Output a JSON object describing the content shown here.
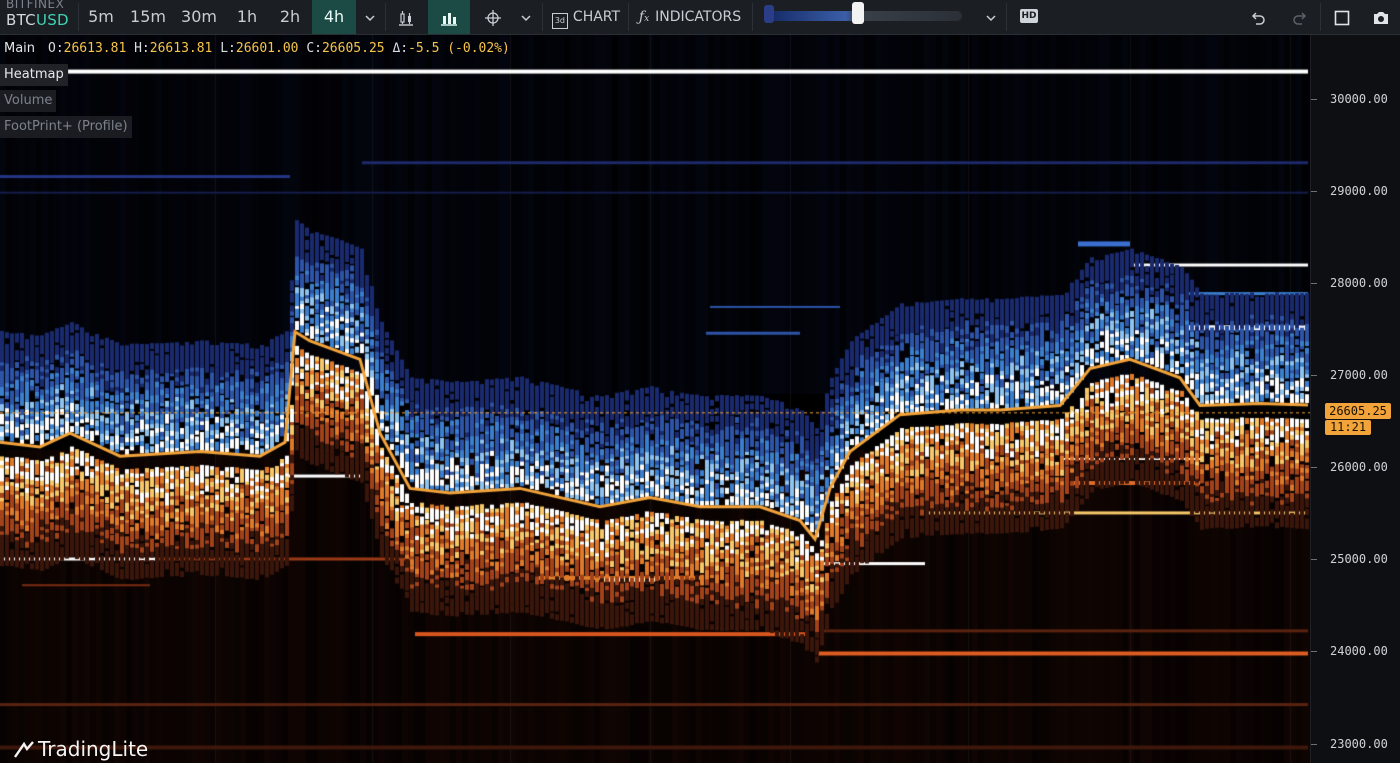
{
  "symbol": {
    "exchange": "BITFINEX",
    "base": "BTC",
    "quote": "USD"
  },
  "timeframes": [
    "5m",
    "15m",
    "30m",
    "1h",
    "2h",
    "4h"
  ],
  "active_timeframe": "4h",
  "toolbar": {
    "chart_label": "CHART",
    "chart_icon_text": "3d",
    "indicators_label": "INDICATORS",
    "hd_label": "HD"
  },
  "legend": {
    "main": "Main",
    "open_label": "O:",
    "open": "26613.81",
    "high_label": "H:",
    "high": "26613.81",
    "low_label": "L:",
    "low": "26601.00",
    "close_label": "C:",
    "close": "26605.25",
    "delta_label": "Δ:",
    "delta": "-5.5 (-0.02%)",
    "heatmap": "Heatmap",
    "volume": "Volume",
    "footprint": "FootPrint+ (Profile)"
  },
  "price_axis": {
    "ticks": [
      {
        "price": 30000,
        "label": "30000.00"
      },
      {
        "price": 29000,
        "label": "29000.00"
      },
      {
        "price": 28000,
        "label": "28000.00"
      },
      {
        "price": 27000,
        "label": "27000.00"
      },
      {
        "price": 26000,
        "label": "26000.00"
      },
      {
        "price": 25000,
        "label": "25000.00"
      },
      {
        "price": 24000,
        "label": "24000.00"
      },
      {
        "price": 23000,
        "label": "23000.00"
      }
    ],
    "last_price": 26605.25,
    "last_price_label": "26605.25",
    "countdown": "11:21",
    "range": [
      22800,
      30700
    ]
  },
  "colors": {
    "accent": "#1c4a44",
    "quote": "#3fd3b4",
    "price_line": "#f2a33a",
    "bid_levels": [
      "#1a2a6e",
      "#2d54a8",
      "#6aa8e0",
      "#ffffff"
    ],
    "ask_levels": [
      "#3a160b",
      "#a3431a",
      "#e07a2a",
      "#f7c86a",
      "#ffffff"
    ]
  },
  "brand": "TradingLite"
}
